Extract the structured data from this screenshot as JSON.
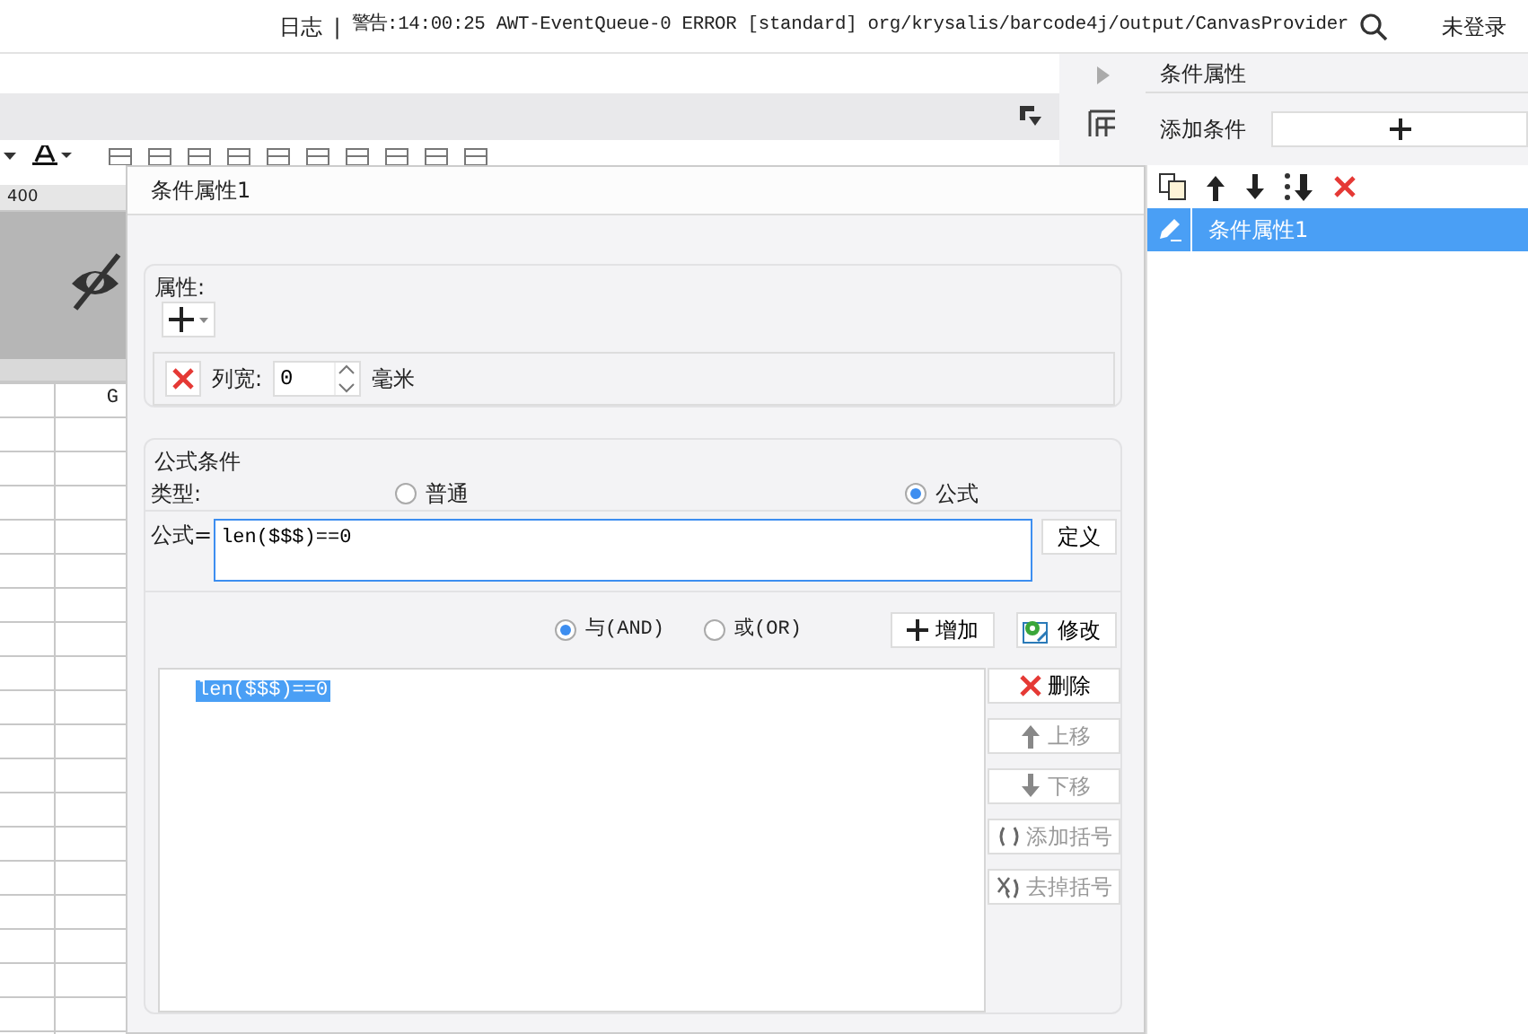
{
  "status_bar": {
    "log_label": "日志",
    "separator": "|",
    "warning": "警告:14:00:25 AWT-EventQueue-0 ERROR [standard] org/krysalis/barcode4j/output/CanvasProvider",
    "login": "未登录"
  },
  "ruler": {
    "mark": "400"
  },
  "sheet": {
    "column_header": "G"
  },
  "dialog": {
    "title": "条件属性1",
    "attributes": {
      "legend": "属性:",
      "width_label": "列宽:",
      "width_value": "0",
      "width_unit": "毫米"
    },
    "formula_condition": {
      "legend": "公式条件",
      "type_label": "类型:",
      "types": [
        {
          "label": "普通",
          "selected": false
        },
        {
          "label": "公式",
          "selected": true
        }
      ],
      "formula_label": "公式=",
      "formula_value": "len($$$)==0",
      "define_button": "定义",
      "logic": [
        {
          "label": "与(AND)",
          "selected": true
        },
        {
          "label": "或(OR)",
          "selected": false
        }
      ],
      "add_button": "增加",
      "modify_button": "修改",
      "conditions": [
        {
          "text": "len($$$)==0",
          "selected": true
        }
      ],
      "side_buttons": [
        {
          "kind": "delete",
          "label": "删除",
          "disabled": false
        },
        {
          "kind": "up",
          "label": "上移",
          "disabled": true
        },
        {
          "kind": "down",
          "label": "下移",
          "disabled": true
        },
        {
          "kind": "add-paren",
          "label": "添加括号",
          "disabled": true
        },
        {
          "kind": "remove-paren",
          "label": "去掉括号",
          "disabled": true
        }
      ]
    }
  },
  "panel": {
    "title": "条件属性",
    "add_label": "添加条件",
    "items": [
      {
        "label": "条件属性1",
        "selected": true
      }
    ]
  }
}
